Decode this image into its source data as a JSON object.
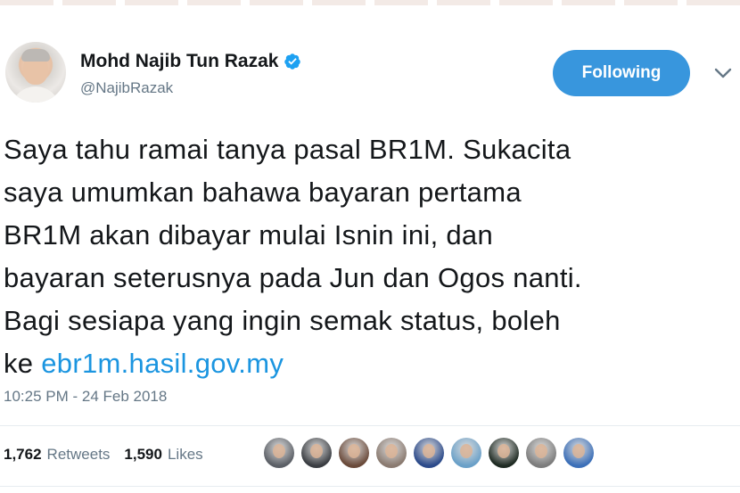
{
  "header": {
    "display_name": "Mohd Najib Tun Razak",
    "handle": "@NajibRazak",
    "follow_label": "Following",
    "icons": {
      "verified": "verified-badge-icon",
      "menu": "chevron-down-icon"
    }
  },
  "tweet": {
    "lines": [
      "Saya tahu ramai tanya pasal BR1M. Sukacita",
      "saya umumkan bahawa bayaran pertama",
      "BR1M akan dibayar mulai Isnin ini, dan",
      "bayaran seterusnya pada Jun dan Ogos nanti.",
      "Bagi sesiapa yang ingin semak status, boleh"
    ],
    "last_line_prefix": "ke ",
    "link_text": "ebr1m.hasil.gov.my",
    "timestamp": "10:25 PM - 24 Feb 2018"
  },
  "stats": {
    "retweets_count": "1,762",
    "retweets_label": "Retweets",
    "likes_count": "1,590",
    "likes_label": "Likes"
  },
  "likers": [
    {
      "name": "liker-avatar-1",
      "color": "#5b5f66"
    },
    {
      "name": "liker-avatar-2",
      "color": "#3a3d42"
    },
    {
      "name": "liker-avatar-3",
      "color": "#6a4a3a"
    },
    {
      "name": "liker-avatar-4",
      "color": "#8a7a70"
    },
    {
      "name": "liker-avatar-5",
      "color": "#2b4a8a"
    },
    {
      "name": "liker-avatar-6",
      "color": "#6aa0c8"
    },
    {
      "name": "liker-avatar-7",
      "color": "#1e2a22"
    },
    {
      "name": "liker-avatar-8",
      "color": "#7c7c7c"
    },
    {
      "name": "liker-avatar-9",
      "color": "#3b6fb8"
    }
  ],
  "colors": {
    "accent": "#3896dd",
    "link": "#1b95e0",
    "secondary_text": "#657786",
    "verified": "#1da1f2"
  }
}
